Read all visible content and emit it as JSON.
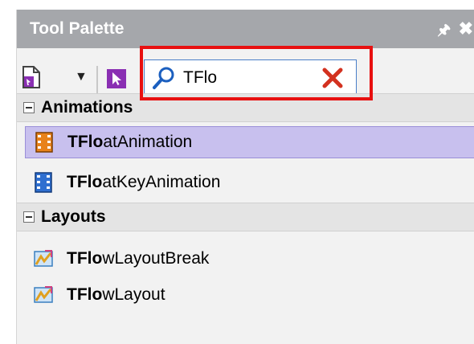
{
  "palette": {
    "title": "Tool Palette"
  },
  "search": {
    "value": "TFlo"
  },
  "categories": [
    {
      "label": "Animations",
      "items": [
        {
          "bold": "TFlo",
          "rest": "atAnimation",
          "selected": true,
          "icon": "animation-icon"
        },
        {
          "bold": "TFlo",
          "rest": "atKeyAnimation",
          "selected": false,
          "icon": "key-animation-icon"
        }
      ]
    },
    {
      "label": "Layouts",
      "items": [
        {
          "bold": "TFlo",
          "rest": "wLayoutBreak",
          "selected": false,
          "icon": "layout-icon"
        },
        {
          "bold": "TFlo",
          "rest": "wLayout",
          "selected": false,
          "icon": "layout-icon"
        }
      ]
    }
  ],
  "colors": {
    "title_bar": "#a5a7ab",
    "selection": "#c8c0ee",
    "highlight": "#e81010"
  }
}
